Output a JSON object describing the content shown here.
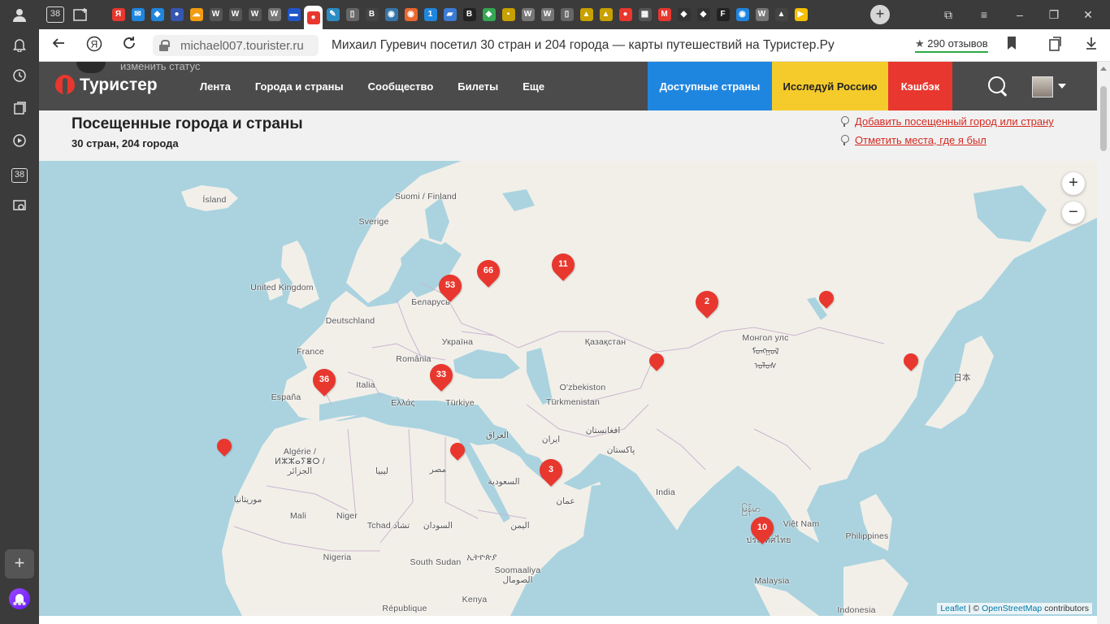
{
  "browser": {
    "tab_badge": "38",
    "tab_favicons": [
      {
        "icon": "yandex-icon",
        "glyph": "Я",
        "color": "#e8372e"
      },
      {
        "icon": "mail-icon",
        "glyph": "✉",
        "color": "#1f86e0"
      },
      {
        "icon": "app-icon",
        "glyph": "◆",
        "color": "#1f86e0"
      },
      {
        "icon": "user-icon",
        "glyph": "●",
        "color": "#3556b0"
      },
      {
        "icon": "cloud-icon",
        "glyph": "☁",
        "color": "#f39c12"
      },
      {
        "icon": "bookmark-w-icon",
        "glyph": "W",
        "color": "#555"
      },
      {
        "icon": "bookmark-w-icon",
        "glyph": "W",
        "color": "#555"
      },
      {
        "icon": "bookmark-w-icon",
        "glyph": "W",
        "color": "#555"
      },
      {
        "icon": "wikipedia-icon",
        "glyph": "W",
        "color": "#777"
      },
      {
        "icon": "flag-icon",
        "glyph": "▬",
        "color": "#2156c9"
      },
      {
        "icon": "touristr-icon",
        "glyph": "●",
        "color": "#e8372e",
        "active": true
      },
      {
        "icon": "map-icon",
        "glyph": "✎",
        "color": "#2b8cc4"
      },
      {
        "icon": "doc-icon",
        "glyph": "▯",
        "color": "#666"
      },
      {
        "icon": "b-icon",
        "glyph": "B",
        "color": "#444"
      },
      {
        "icon": "python-icon",
        "glyph": "◉",
        "color": "#3776ab"
      },
      {
        "icon": "orange-icon",
        "glyph": "◉",
        "color": "#e8682e"
      },
      {
        "icon": "one-icon",
        "glyph": "1",
        "color": "#1f86e0"
      },
      {
        "icon": "book-icon",
        "glyph": "▰",
        "color": "#3a7bd5"
      },
      {
        "icon": "b-round-icon",
        "glyph": "B",
        "color": "#222"
      },
      {
        "icon": "maps-pin-icon",
        "glyph": "◆",
        "color": "#34a853"
      },
      {
        "icon": "dots-icon",
        "glyph": "▪",
        "color": "#c8a000"
      },
      {
        "icon": "wikipedia-icon",
        "glyph": "W",
        "color": "#777"
      },
      {
        "icon": "wikipedia-icon",
        "glyph": "W",
        "color": "#777"
      },
      {
        "icon": "doc-icon",
        "glyph": "▯",
        "color": "#666"
      },
      {
        "icon": "image-icon",
        "glyph": "▲",
        "color": "#c8a000"
      },
      {
        "icon": "image-icon",
        "glyph": "▲",
        "color": "#c8a000"
      },
      {
        "icon": "red-drop-icon",
        "glyph": "●",
        "color": "#e8372e"
      },
      {
        "icon": "scan-icon",
        "glyph": "▦",
        "color": "#555"
      },
      {
        "icon": "m-icon",
        "glyph": "M",
        "color": "#e8372e"
      },
      {
        "icon": "dark-icon",
        "glyph": "◆",
        "color": "#333"
      },
      {
        "icon": "dark-icon",
        "glyph": "◆",
        "color": "#333"
      },
      {
        "icon": "f-icon",
        "glyph": "F",
        "color": "#222"
      },
      {
        "icon": "blue-round-icon",
        "glyph": "◉",
        "color": "#1f86e0"
      },
      {
        "icon": "wikipedia-icon",
        "glyph": "W",
        "color": "#777"
      },
      {
        "icon": "mountain-icon",
        "glyph": "▲",
        "color": "#444"
      },
      {
        "icon": "play-icon",
        "glyph": "▶",
        "color": "#f5c000"
      }
    ],
    "sidebar_badge": "38",
    "url": "michael007.tourister.ru",
    "page_title": "Михаил Гуревич посетил 30 стран и 204 города — карты путешествий на Туристер.Ру",
    "reviews": "290 отзывов"
  },
  "site": {
    "status_peek": "изменить статус",
    "logo": "Туристер",
    "nav": [
      "Лента",
      "Города и страны",
      "Сообщество",
      "Билеты",
      "Еще"
    ],
    "promo": {
      "available_countries": "Доступные страны",
      "explore_russia": "Исследуй Россию",
      "cashback": "Кэшбэк"
    },
    "colors": {
      "brand_red": "#e8372e",
      "promo_blue": "#1f86e0",
      "promo_yellow": "#f5cb2b"
    }
  },
  "visited": {
    "title": "Посещенные города и страны",
    "subtitle": "30 стран, 204 города",
    "add_link": "Добавить посещенный город или страну",
    "mark_link": "Отметить места, где я был"
  },
  "map": {
    "zoom_in": "+",
    "zoom_out": "−",
    "attribution": {
      "leaflet": "Leaflet",
      "sep": " | © ",
      "osm": "OpenStreetMap",
      "tail": " contributors"
    },
    "labels": [
      "Ísland",
      "Suomi / Finland",
      "Sverige",
      "United Kingdom",
      "Беларусь",
      "Deutschland",
      "Україна",
      "France",
      "România",
      "Қазақстан",
      "Монгол улс ᠮᠣᠩᠭᠣᠯ ᠤᠯᠤᠰ",
      "Italia",
      "España",
      "Ελλάς",
      "Türkiye",
      "O'zbekiston",
      "Türkmenistan",
      "日本",
      "العراق",
      "ایران",
      "افغانستان",
      "پاکستان",
      "Algérie / ⵍⵣⵣⴰⵢⴻⵔ / الجزائر",
      "ليبيا",
      "مصر",
      "السعودية",
      "عمان",
      "India",
      "موريتانيا",
      "Mali",
      "Niger",
      "Tchad تشاد",
      "السودان",
      "اليمن",
      "Việt Nam",
      "Philippines",
      "မြန်မာ",
      "ประเทศไทย",
      "Nigeria",
      "South Sudan",
      "ኢትዮጵያ",
      "Soomaaliya الصومال",
      "Malaysia",
      "République",
      "Kenya",
      "Indonesia"
    ],
    "markers": [
      {
        "count": "66",
        "place": "Russia (central)"
      },
      {
        "count": "53",
        "place": "Belarus"
      },
      {
        "count": "11",
        "place": "Russia (Urals)"
      },
      {
        "count": "2",
        "place": "Russia (Siberia)"
      },
      {
        "count": "",
        "place": "Russia (Baikal)"
      },
      {
        "count": "",
        "place": "Kazakhstan"
      },
      {
        "count": "",
        "place": "Russia (Far East)"
      },
      {
        "count": "36",
        "place": "Spain"
      },
      {
        "count": "33",
        "place": "Turkey"
      },
      {
        "count": "",
        "place": "Canary Islands"
      },
      {
        "count": "",
        "place": "Egypt"
      },
      {
        "count": "3",
        "place": "UAE"
      },
      {
        "count": "10",
        "place": "Thailand"
      }
    ]
  }
}
